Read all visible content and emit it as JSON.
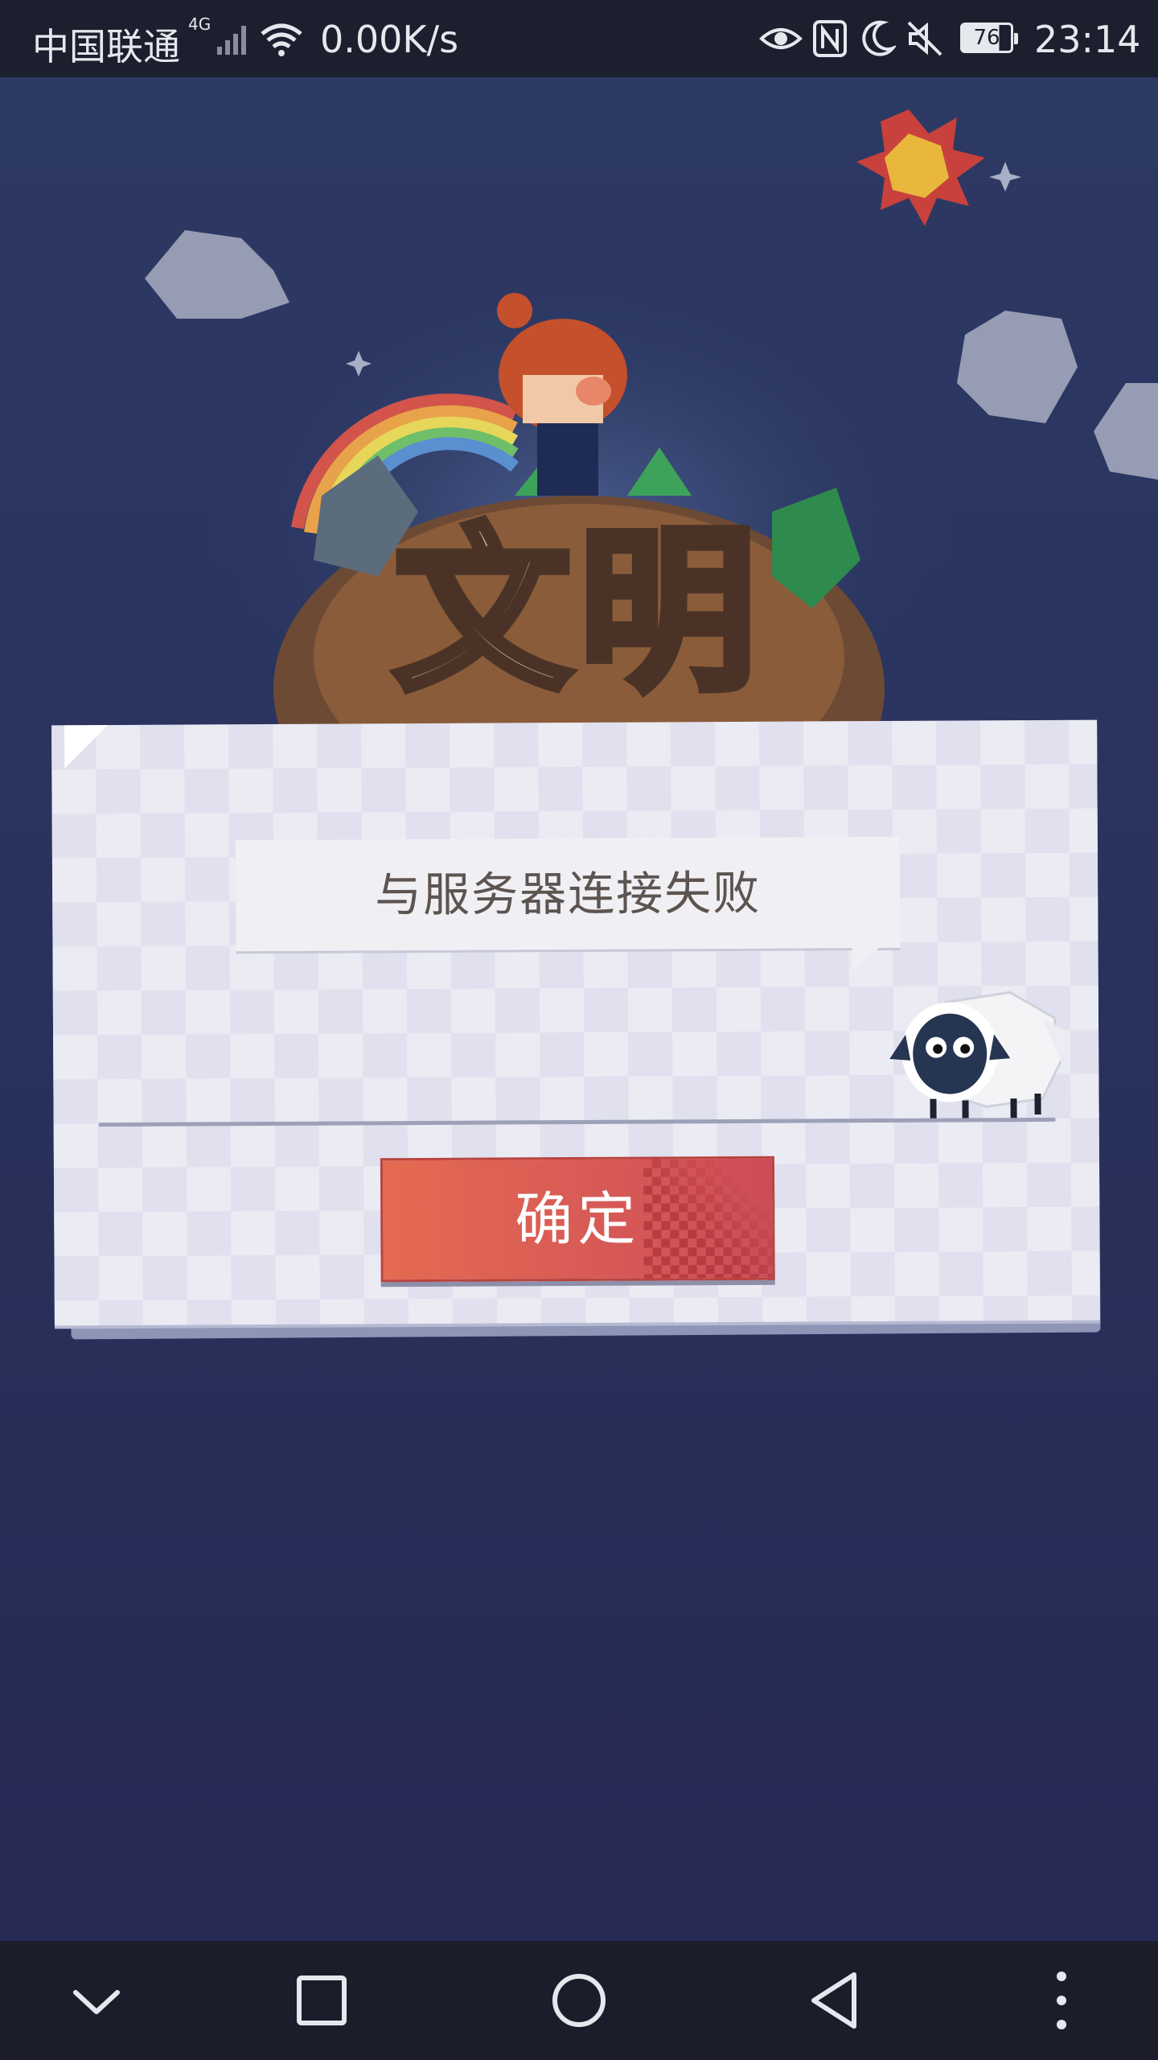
{
  "status_bar": {
    "carrier": "中国联通",
    "network_type": "4G",
    "net_speed": "0.00K/s",
    "battery_level": "76",
    "time": "23:14",
    "icons": [
      "signal-icon",
      "wifi-icon",
      "eye-comfort-icon",
      "nfc-icon",
      "moon-icon",
      "mute-icon",
      "battery-icon"
    ]
  },
  "game": {
    "logo_text": "文明"
  },
  "dialog": {
    "message": "与服务器连接失败",
    "confirm_label": "确定"
  },
  "nav_bar": {
    "icons": [
      "chevron-down-icon",
      "recent-apps-icon",
      "home-icon",
      "back-icon",
      "more-icon"
    ]
  },
  "colors": {
    "background": "#2a3560",
    "dialog": "#e0e0ee",
    "button": "#d85a56",
    "message_text": "#5d5450"
  }
}
